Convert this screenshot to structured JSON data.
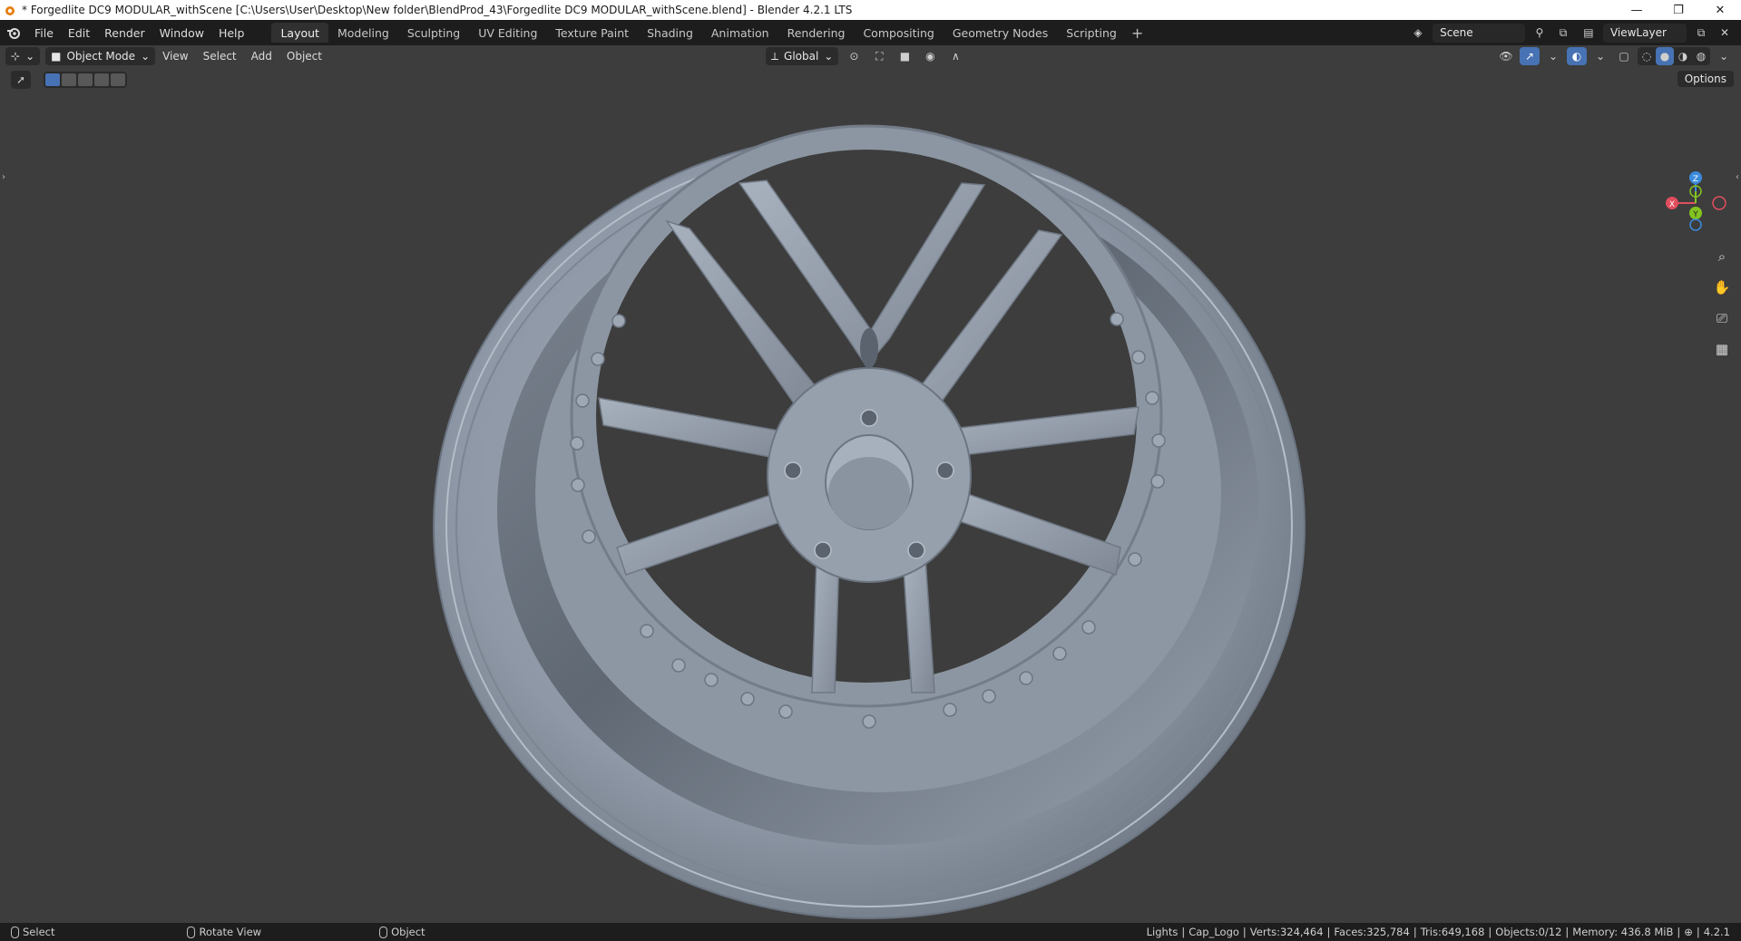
{
  "window": {
    "title": "* Forgedlite DC9 MODULAR_withScene [C:\\Users\\User\\Desktop\\New folder\\BlendProd_43\\Forgedlite DC9 MODULAR_withScene.blend] - Blender 4.2.1 LTS",
    "minimize": "—",
    "maximize": "❐",
    "close": "✕"
  },
  "menu": [
    "File",
    "Edit",
    "Render",
    "Window",
    "Help"
  ],
  "workspaces": [
    "Layout",
    "Modeling",
    "Sculpting",
    "UV Editing",
    "Texture Paint",
    "Shading",
    "Animation",
    "Rendering",
    "Compositing",
    "Geometry Nodes",
    "Scripting"
  ],
  "active_workspace": "Layout",
  "scene": {
    "label": "Scene"
  },
  "view_layer": {
    "label": "ViewLayer"
  },
  "viewport_header": {
    "mode": "Object Mode",
    "menus": [
      "View",
      "Select",
      "Add",
      "Object"
    ],
    "orientation": "Global"
  },
  "options_label": "Options",
  "gizmo": {
    "x": "X",
    "y": "Y",
    "z": "Z"
  },
  "status": {
    "hints": [
      "Select",
      "Rotate View",
      "Object"
    ],
    "collection": "Lights",
    "active_object": "Cap_Logo",
    "verts": "Verts:324,464",
    "faces": "Faces:325,784",
    "tris": "Tris:649,168",
    "objects": "Objects:0/12",
    "memory": "Memory: 436.8 MiB",
    "version": "4.2.1"
  },
  "colors": {
    "accent": "#4772b3",
    "viewport_bg": "#3d3d3d",
    "bar_bg": "#1d1d1d",
    "axis_x": "#e04e5e",
    "axis_y": "#83c420",
    "axis_z": "#3b8bdc"
  }
}
